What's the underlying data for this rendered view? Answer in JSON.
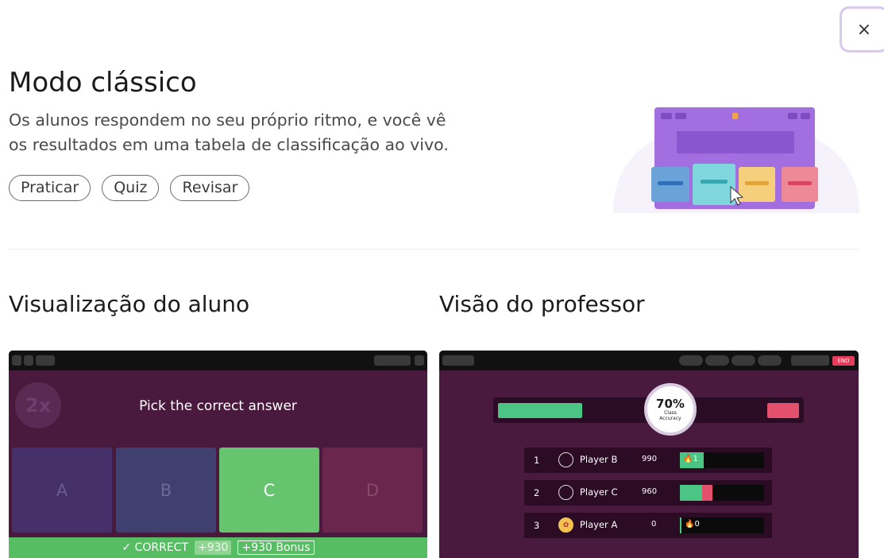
{
  "dialog": {
    "close_label": "×",
    "title": "Modo clássico",
    "description_lines": [
      "Os alunos respondem no seu próprio ritmo, e você vê",
      "os resultados em uma tabela de classificação ao vivo."
    ],
    "tags": [
      "Praticar",
      "Quiz",
      "Revisar"
    ]
  },
  "student_view": {
    "title": "Visualização do aluno",
    "multiplier": "2x",
    "question": "Pick the correct answer",
    "options": [
      "A",
      "B",
      "C",
      "D"
    ],
    "correct_option": "C",
    "result": {
      "label": "✓ CORRECT",
      "points": "+930",
      "bonus": "+930 Bonus"
    }
  },
  "teacher_view": {
    "title": "Visão do professor",
    "end_label": "END",
    "accuracy": {
      "percent": "70%",
      "label": "Class Accuracy",
      "correct_fraction": 0.7
    },
    "leaderboard": [
      {
        "rank": "1",
        "name": "Player B",
        "score": "990",
        "streak": "🔥1",
        "correct_fraction": 0.28,
        "wrong_fraction": 0.0
      },
      {
        "rank": "2",
        "name": "Player C",
        "score": "960",
        "streak": "",
        "correct_fraction": 0.26,
        "wrong_fraction": 0.12
      },
      {
        "rank": "3",
        "name": "Player A",
        "score": "0",
        "streak": "🔥0",
        "correct_fraction": 0.02,
        "wrong_fraction": 0.0
      }
    ]
  },
  "colors": {
    "panel_bg": "#4a1a3e",
    "correct_green": "#57bd63",
    "wrong_red": "#e2506c",
    "accent_purple": "#a36fe0"
  }
}
